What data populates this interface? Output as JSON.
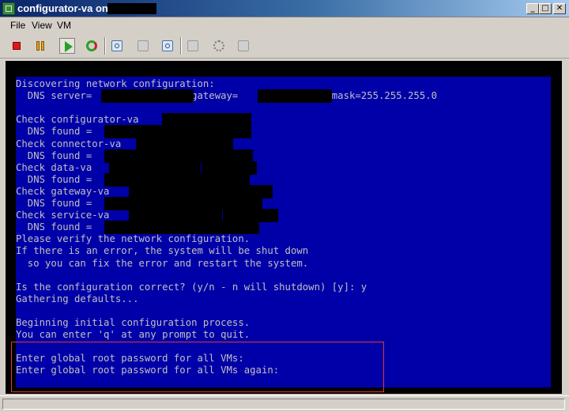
{
  "window": {
    "title": "configurator-va on",
    "controls": {
      "minimize": "_",
      "maximize": "□",
      "close": "✕"
    }
  },
  "menu": [
    "File",
    "View",
    "VM"
  ],
  "toolbar": {
    "buttons": [
      "stop",
      "pause",
      "play",
      "reset",
      "snapshot",
      "revert-snapshot",
      "snapshot-manager",
      "edit-settings",
      "vm-network",
      "vm-devices"
    ]
  },
  "console": {
    "lines": [
      "Discovering network configuration:",
      "  DNS server=               , gateway=           , netmask=255.255.255.0",
      "",
      "Check configurator-va",
      "  DNS found =",
      "Check connector-va",
      "  DNS found =",
      "Check data-va",
      "  DNS found =",
      "Check gateway-va",
      "  DNS found =",
      "Check service-va",
      "  DNS found =",
      "Please verify the network configuration.",
      "If there is an error, the system will be shut down",
      "  so you can fix the error and restart the system.",
      "",
      "Is the configuration correct? (y/n - n will shutdown) [y]: y",
      "Gathering defaults...",
      "",
      "Beginning initial configuration process.",
      "You can enter 'q' at any prompt to quit.",
      "",
      "Enter global root password for all VMs:",
      "Enter global root password for all VMs again: "
    ]
  }
}
